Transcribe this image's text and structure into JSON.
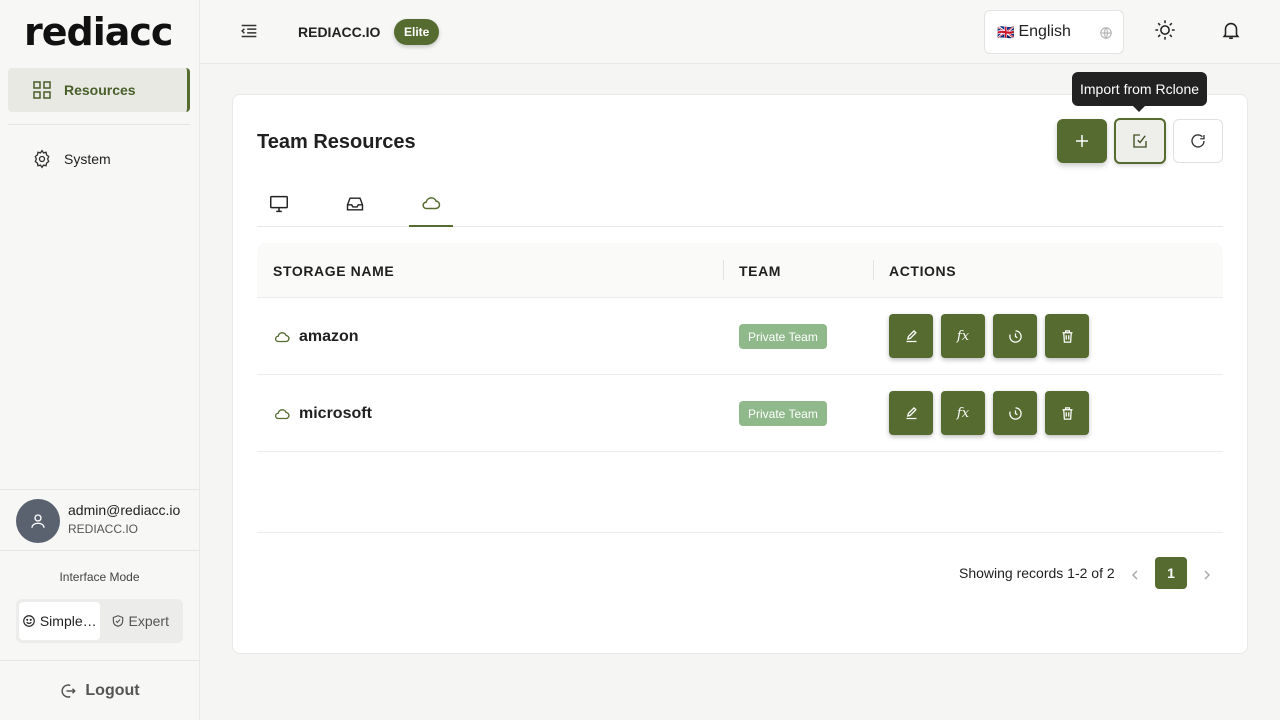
{
  "brand": {
    "logo_text": "rediacc",
    "accent": "#556b2f"
  },
  "sidebar": {
    "items": [
      {
        "label": "Resources",
        "icon": "grid-icon",
        "active": true
      },
      {
        "label": "System",
        "icon": "gear-icon",
        "active": false
      }
    ],
    "user": {
      "email": "admin@rediacc.io",
      "org": "REDIACC.IO"
    },
    "interface_mode": {
      "label": "Interface Mode",
      "options": [
        "Simple…",
        "Expert"
      ],
      "selected": "Simple…"
    },
    "logout_label": "Logout"
  },
  "header": {
    "org_name": "REDIACC.IO",
    "plan_badge": "Elite",
    "language": {
      "flag": "🇬🇧",
      "label": "English"
    }
  },
  "card": {
    "title": "Team Resources",
    "tooltip": "Import from Rclone",
    "tabs": [
      {
        "icon": "monitor-icon",
        "active": false
      },
      {
        "icon": "inbox-icon",
        "active": false
      },
      {
        "icon": "cloud-icon",
        "active": true
      }
    ],
    "table": {
      "columns": [
        "STORAGE NAME",
        "TEAM",
        "ACTIONS"
      ],
      "rows": [
        {
          "name": "amazon",
          "team": "Private Team"
        },
        {
          "name": "microsoft",
          "team": "Private Team"
        }
      ],
      "function_label": "fx"
    },
    "pagination": {
      "summary": "Showing records 1-2 of 2",
      "current_page": "1"
    }
  }
}
